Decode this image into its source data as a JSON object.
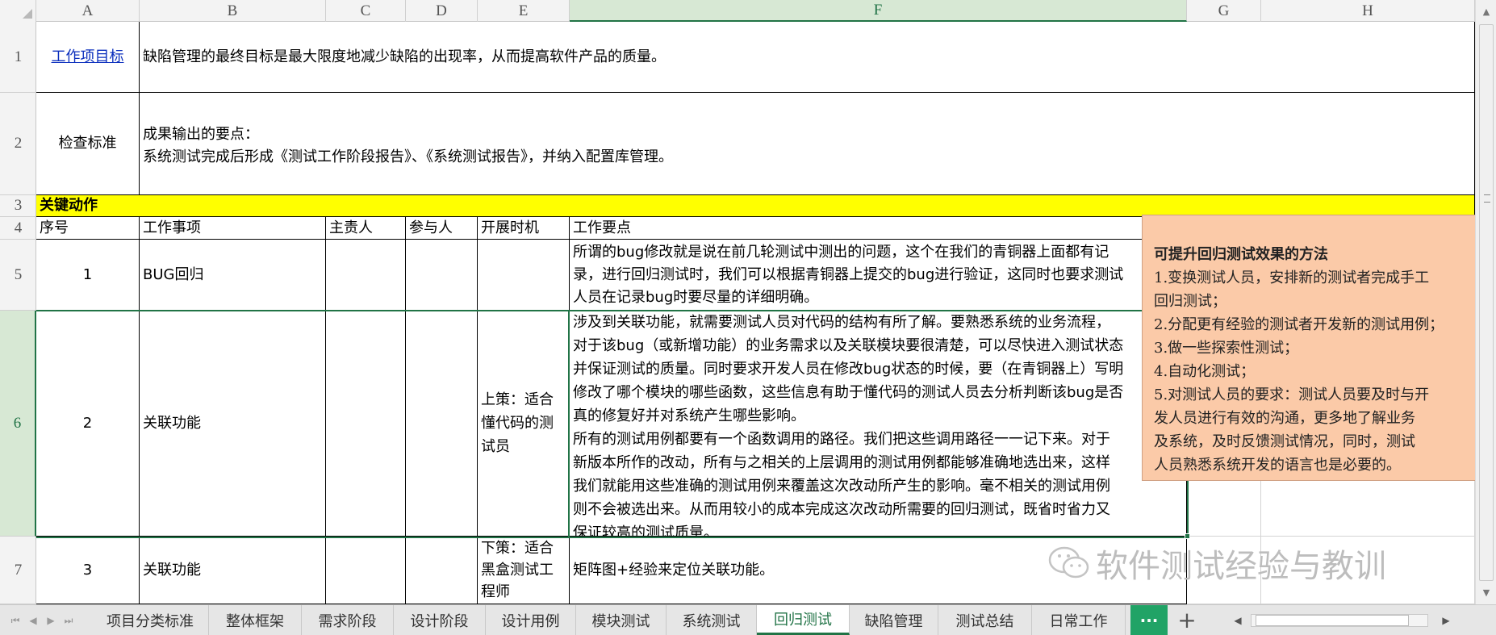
{
  "columns": [
    "A",
    "B",
    "C",
    "D",
    "E",
    "F",
    "G",
    "H"
  ],
  "selected_column": "F",
  "rows": [
    "1",
    "2",
    "3",
    "4",
    "5",
    "6",
    "7"
  ],
  "selected_row": "6",
  "r1": {
    "label": "工作项目标",
    "text": "缺陷管理的最终目标是最大限度地减少缺陷的出现率，从而提高软件产品的质量。"
  },
  "r2": {
    "label": "检查标准",
    "line1": "成果输出的要点：",
    "line2": "系统测试完成后形成《测试工作阶段报告》、《系统测试报告》，并纳入配置库管理。"
  },
  "r3": {
    "title": "关键动作"
  },
  "headers": {
    "seq": "序号",
    "item": "工作事项",
    "owner": "主责人",
    "participant": "参与人",
    "timing": "开展时机",
    "points": "工作要点"
  },
  "r5": {
    "seq": "1",
    "item": "BUG回归",
    "points": [
      "所谓的bug修改就是说在前几轮测试中测出的问题，这个在我们的青铜器上面都有记",
      "录，进行回归测试时，我们可以根据青铜器上提交的bug进行验证，这同时也要求测试",
      "人员在记录bug时要尽量的详细明确。"
    ]
  },
  "r6": {
    "seq": "2",
    "item": "关联功能",
    "timing": "上策：适合懂代码的测试员",
    "points": [
      "涉及到关联功能，就需要测试人员对代码的结构有所了解。要熟悉系统的业务流程，",
      "对于该bug（或新增功能）的业务需求以及关联模块要很清楚，可以尽快进入测试状态",
      "并保证测试的质量。同时要求开发人员在修改bug状态的时候，要（在青铜器上）写明",
      "修改了哪个模块的哪些函数，这些信息有助于懂代码的测试人员去分析判断该bug是否",
      "真的修复好并对系统产生哪些影响。",
      "所有的测试用例都要有一个函数调用的路径。我们把这些调用路径一一记下来。对于",
      "新版本所作的改动，所有与之相关的上层调用的测试用例都能够准确地选出来，这样",
      "我们就能用这些准确的测试用例来覆盖这次改动所产生的影响。毫不相关的测试用例",
      "则不会被选出来。从而用较小的成本完成这次改动所需要的回归测试，既省时省力又",
      "保证较高的测试质量。"
    ]
  },
  "r7": {
    "seq": "3",
    "item": "关联功能",
    "timing": "下策：适合黑盒测试工程师",
    "points": "矩阵图+经验来定位关联功能。"
  },
  "comment": {
    "title": "可提升回归测试效果的方法",
    "lines": [
      "1.变换测试人员，安排新的测试者完成手工",
      "回归测试；",
      "2.分配更有经验的测试者开发新的测试用例；",
      "3.做一些探索性测试；",
      "4.自动化测试；",
      "5.对测试人员的要求：测试人员要及时与开",
      "发人员进行有效的沟通，更多地了解业务",
      "及系统，及时反馈测试情况，同时，测试",
      "人员熟悉系统开发的语言也是必要的。"
    ]
  },
  "watermark": "软件测试经验与教训",
  "sheet_tabs": [
    "项目分类标准",
    "整体框架",
    "需求阶段",
    "设计阶段",
    "设计用例",
    "模块测试",
    "系统测试",
    "回归测试",
    "缺陷管理",
    "测试总结",
    "日常工作"
  ],
  "active_tab": "回归测试",
  "more_tabs": "···",
  "add_tab": "+",
  "colors": {
    "accent": "#217346",
    "highlight": "#ffff00",
    "comment_bg": "#fbcaa8",
    "tab_more": "#21a366"
  }
}
